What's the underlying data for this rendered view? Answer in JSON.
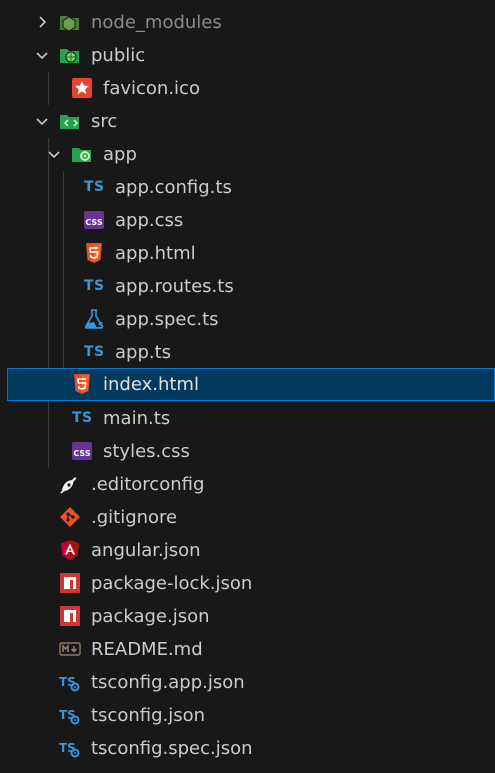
{
  "explorer": {
    "items": [
      {
        "label": "node_modules",
        "icon": "folder-node-icon",
        "expanded": false
      },
      {
        "label": "public",
        "icon": "folder-public-icon",
        "expanded": true
      },
      {
        "label": "favicon.ico",
        "icon": "favicon-icon"
      },
      {
        "label": "src",
        "icon": "folder-src-icon",
        "expanded": true
      },
      {
        "label": "app",
        "icon": "folder-app-icon",
        "expanded": true
      },
      {
        "label": "app.config.ts",
        "icon": "typescript-icon",
        "badge": "TS"
      },
      {
        "label": "app.css",
        "icon": "css-icon"
      },
      {
        "label": "app.html",
        "icon": "html-icon"
      },
      {
        "label": "app.routes.ts",
        "icon": "typescript-icon",
        "badge": "TS"
      },
      {
        "label": "app.spec.ts",
        "icon": "test-spec-icon"
      },
      {
        "label": "app.ts",
        "icon": "typescript-icon",
        "badge": "TS"
      },
      {
        "label": "index.html",
        "icon": "html-icon",
        "selected": true
      },
      {
        "label": "main.ts",
        "icon": "typescript-icon",
        "badge": "TS"
      },
      {
        "label": "styles.css",
        "icon": "css-icon"
      },
      {
        "label": ".editorconfig",
        "icon": "editorconfig-icon"
      },
      {
        "label": ".gitignore",
        "icon": "git-icon"
      },
      {
        "label": "angular.json",
        "icon": "angular-icon"
      },
      {
        "label": "package-lock.json",
        "icon": "npm-icon"
      },
      {
        "label": "package.json",
        "icon": "npm-icon"
      },
      {
        "label": "README.md",
        "icon": "markdown-icon"
      },
      {
        "label": "tsconfig.app.json",
        "icon": "tsconfig-icon"
      },
      {
        "label": "tsconfig.json",
        "icon": "tsconfig-icon"
      },
      {
        "label": "tsconfig.spec.json",
        "icon": "tsconfig-icon"
      }
    ]
  },
  "colors": {
    "background": "#181818",
    "text": "#cccccc",
    "selection_bg": "#04395e",
    "selection_border": "#0078d4",
    "ts_blue": "#3b94d6",
    "html_orange": "#e44d26",
    "css_purple": "#663399",
    "npm_red": "#cb3837",
    "folder_green": "#27a04f"
  }
}
